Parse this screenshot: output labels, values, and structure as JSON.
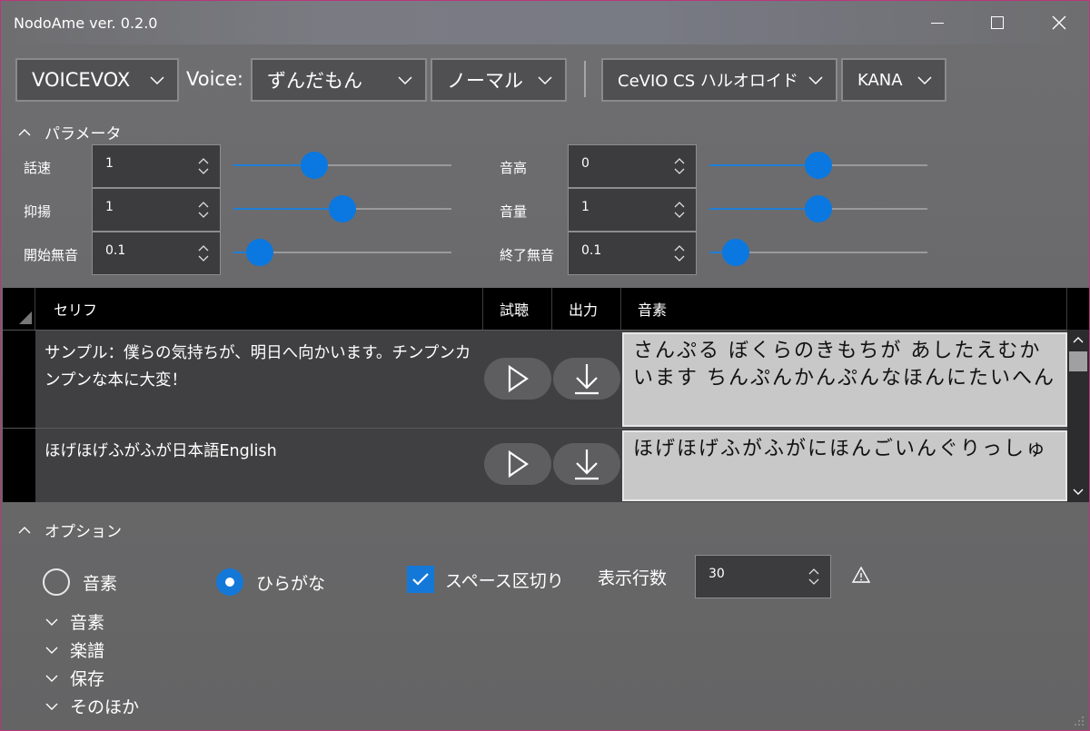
{
  "window": {
    "title": "NodoAme ver. 0.2.0"
  },
  "toolbar": {
    "engine": "VOICEVOX",
    "voice_label": "Voice:",
    "voice": "ずんだもん",
    "style": "ノーマル",
    "external_app": "CeVIO CS ハルオロイド",
    "external_mode": "KANA"
  },
  "params": {
    "section_label": "パラメータ",
    "items": [
      {
        "label": "話速",
        "value": "1",
        "level": 0.37
      },
      {
        "label": "抑揚",
        "value": "1",
        "level": 0.5
      },
      {
        "label": "開始無音",
        "value": "0.1",
        "level": 0.12
      },
      {
        "label": "音高",
        "value": "0",
        "level": 0.5
      },
      {
        "label": "音量",
        "value": "1",
        "level": 0.5
      },
      {
        "label": "終了無音",
        "value": "0.1",
        "level": 0.12
      }
    ]
  },
  "grid": {
    "columns": [
      "セリフ",
      "試聴",
      "出力",
      "音素"
    ],
    "rows": [
      {
        "serif": "サンプル：僕らの気持ちが、明日へ向かいます。チンプンカンプンな本に大変！",
        "phoneme": "さんぷる ぼくらのきもちが あしたえむかいます ちんぷんかんぷんなほんにたいへん"
      },
      {
        "serif": "ほげほげふがふが日本語English",
        "phoneme": "ほげほげふがふがにほんごいんぐりっしゅ"
      }
    ]
  },
  "options": {
    "section_label": "オプション",
    "radio_phoneme": "音素",
    "radio_hiragana": "ひらがな",
    "space_split": "スペース区切り",
    "rows_label": "表示行数",
    "rows_value": "30",
    "expanders": [
      "音素",
      "楽譜",
      "保存",
      "そのほか"
    ]
  },
  "colors": {
    "accent": "#1478d8",
    "background": "#6a6a6c"
  }
}
